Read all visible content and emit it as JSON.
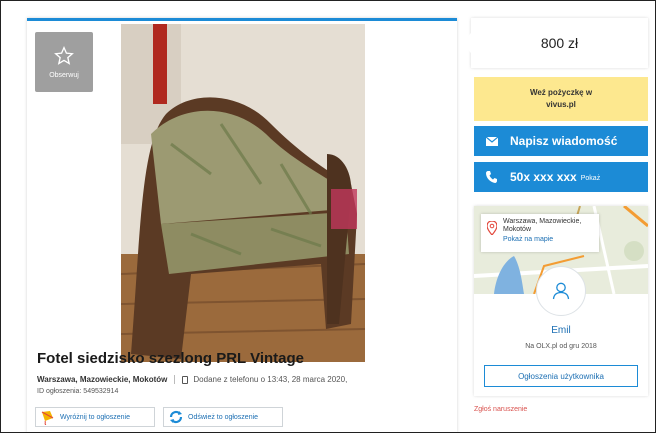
{
  "listing": {
    "observe_label": "Obserwuj",
    "title": "Fotel siedzisko szezlong PRL Vintage",
    "location": "Warszawa, Mazowieckie, Mokotów",
    "added": "Dodane z telefonu  o 13:43, 28 marca 2020,",
    "ad_id": "ID ogłoszenia: 549532914",
    "promote_label": "Wyróżnij to ogłoszenie",
    "refresh_label": "Odśwież to ogłoszenie"
  },
  "sidebar": {
    "price": "800 zł",
    "loan_line1": "Weź pożyczkę w",
    "loan_line2": "vivus.pl",
    "message_label": "Napisz wiadomość",
    "phone_label": "50x xxx xxx",
    "phone_show": "Pokaż",
    "map_location": "Warszawa, Mazowieckie, Mokotów",
    "map_link": "Pokaż na mapie",
    "seller_name": "Emil",
    "seller_since": "Na OLX.pl od gru 2018",
    "seller_ads_button": "Ogłoszenia użytkownika",
    "report_label": "Zgłoś naruszenie"
  },
  "colors": {
    "accent_blue": "#1c8bd6",
    "loan_yellow": "#fde88f",
    "report_red": "#d9534f"
  },
  "icons": [
    "star-icon",
    "phone-icon",
    "envelope-icon",
    "map-pin-icon",
    "user-icon",
    "kite-icon",
    "refresh-icon"
  ]
}
